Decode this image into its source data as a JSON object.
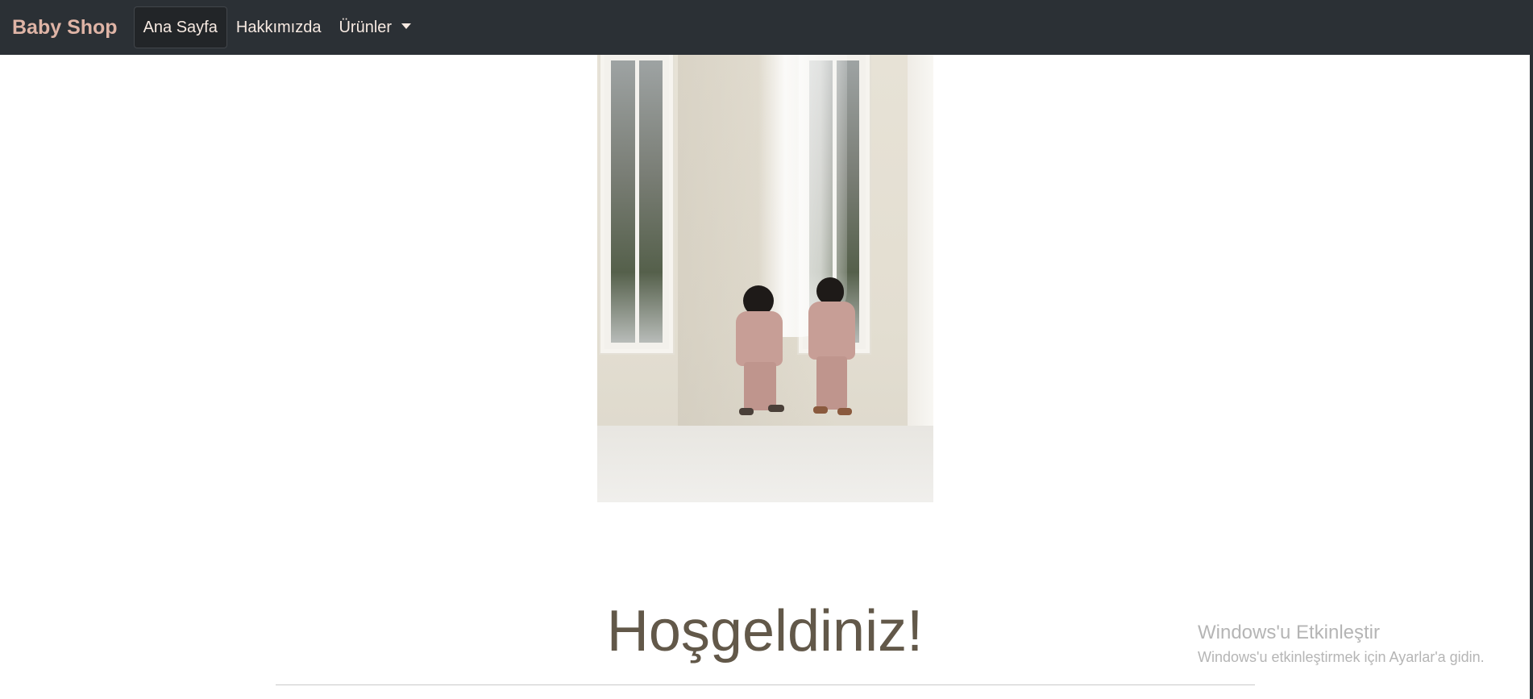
{
  "navbar": {
    "brand": "Baby Shop",
    "items": [
      {
        "label": "Ana Sayfa",
        "active": true
      },
      {
        "label": "Hakkımızda",
        "active": false
      },
      {
        "label": "Ürünler",
        "active": false,
        "dropdown": true
      }
    ]
  },
  "hero": {
    "image": "photo-three-toddlers-at-window-curtain",
    "icon": "hero-photo"
  },
  "welcome": {
    "heading": "Hoşgeldiniz!"
  },
  "watermark": {
    "title": "Windows'u Etkinleştir",
    "subtitle": "Windows'u etkinleştirmek için Ayarlar'a gidin."
  },
  "colors": {
    "navbar_bg": "#2b3035",
    "brand": "#dfb4a6",
    "nav_text": "#f7eae2",
    "heading": "#625849",
    "watermark": "#b5b5b5"
  }
}
